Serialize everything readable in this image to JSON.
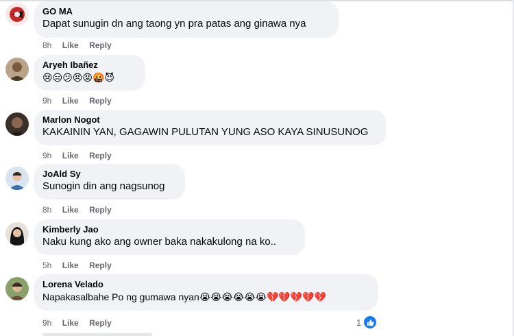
{
  "comments": [
    {
      "author": "GO MA",
      "text": "Dapat sunugin dn ang taong yn pra patas ang ginawa nya",
      "time": "8h",
      "like": "Like",
      "reply": "Reply",
      "avatar_icon": "party-logo-avatar"
    },
    {
      "author": "Aryeh Ibañez",
      "text": "😢😑😕😠😡🤬😈",
      "time": "9h",
      "like": "Like",
      "reply": "Reply",
      "avatar_icon": "profile-photo"
    },
    {
      "author": "Marlon Nogot",
      "text": "KAKAININ YAN, GAGAWIN PULUTAN YUNG ASO KAYA SINUSUNOG",
      "time": "9h",
      "like": "Like",
      "reply": "Reply",
      "avatar_icon": "profile-photo"
    },
    {
      "author": "JoAld Sy",
      "text": "Sunogin din ang nagsunog",
      "time": "8h",
      "like": "Like",
      "reply": "Reply",
      "avatar_icon": "profile-photo"
    },
    {
      "author": "Kimberly Jao",
      "text": "Naku kung ako ang owner baka nakakulong na ko..",
      "time": "5h",
      "like": "Like",
      "reply": "Reply",
      "avatar_icon": "profile-photo"
    },
    {
      "author": "Lorena Velado",
      "text": "Napakasalbahe Po ng gumawa nyan😭😭😭😭😭😭💔💔💔💔💔",
      "time": "9h",
      "like": "Like",
      "reply": "Reply",
      "avatar_icon": "profile-photo",
      "reaction_count": "1",
      "reaction_icon": "like-thumb-icon"
    }
  ],
  "colors": {
    "bubble": "#f0f2f5",
    "meta": "#65676b",
    "like_blue": "#1877f2"
  }
}
